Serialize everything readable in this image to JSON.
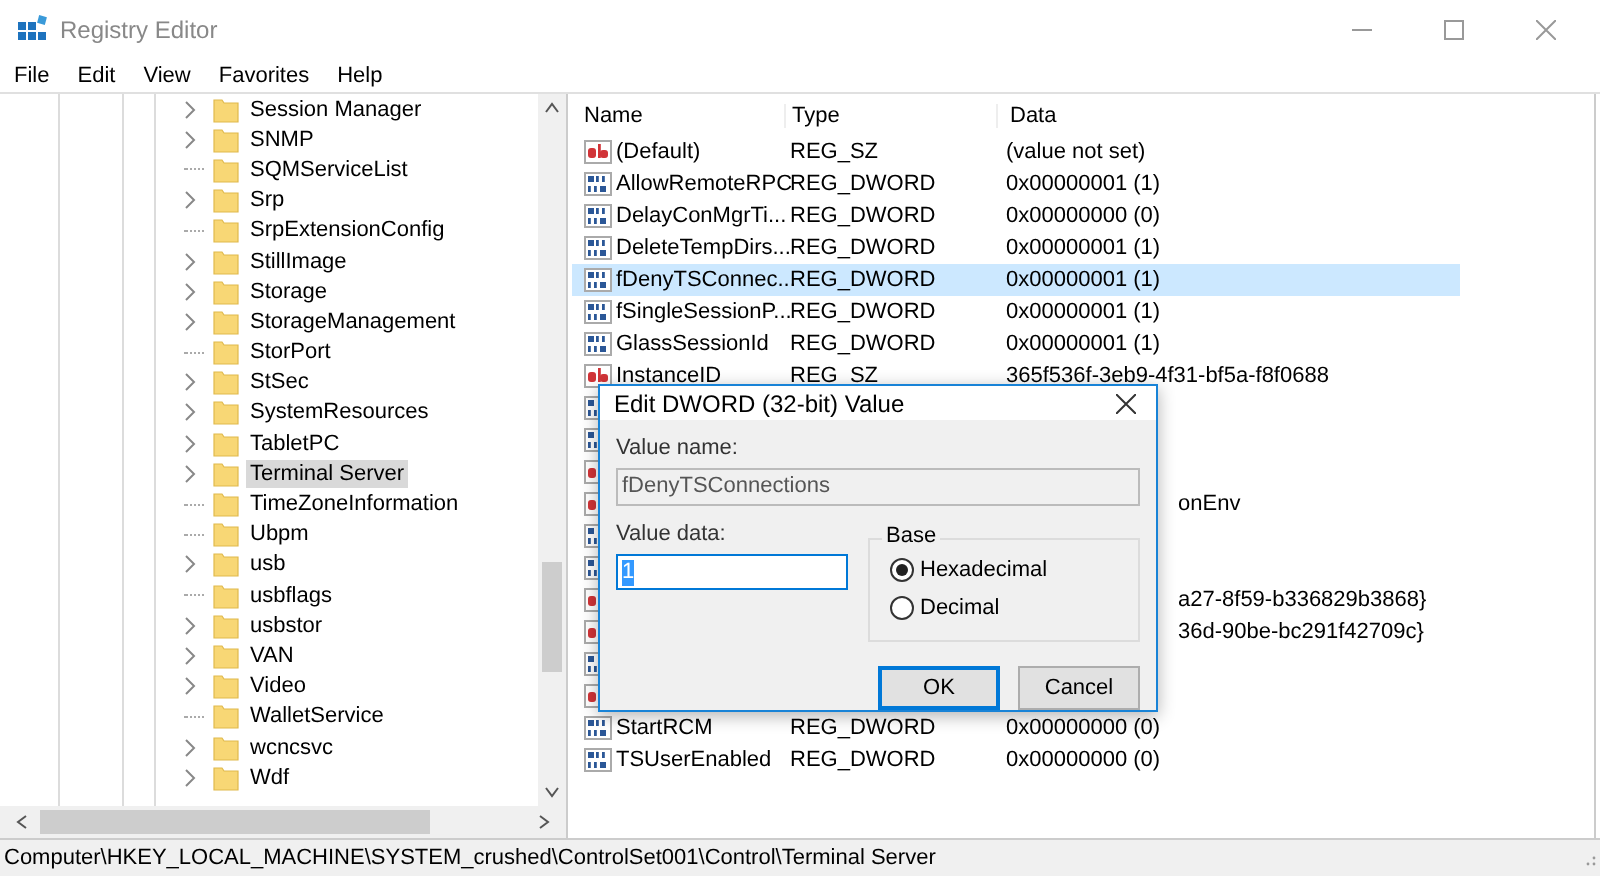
{
  "window": {
    "title": "Registry Editor"
  },
  "menu": [
    "File",
    "Edit",
    "View",
    "Favorites",
    "Help"
  ],
  "tree": {
    "items": [
      {
        "label": "Session Manager",
        "expandable": true,
        "selected": false
      },
      {
        "label": "SNMP",
        "expandable": true,
        "selected": false
      },
      {
        "label": "SQMServiceList",
        "expandable": false,
        "selected": false
      },
      {
        "label": "Srp",
        "expandable": true,
        "selected": false
      },
      {
        "label": "SrpExtensionConfig",
        "expandable": false,
        "selected": false
      },
      {
        "label": "StillImage",
        "expandable": true,
        "selected": false
      },
      {
        "label": "Storage",
        "expandable": true,
        "selected": false
      },
      {
        "label": "StorageManagement",
        "expandable": true,
        "selected": false
      },
      {
        "label": "StorPort",
        "expandable": false,
        "selected": false
      },
      {
        "label": "StSec",
        "expandable": true,
        "selected": false
      },
      {
        "label": "SystemResources",
        "expandable": true,
        "selected": false
      },
      {
        "label": "TabletPC",
        "expandable": true,
        "selected": false
      },
      {
        "label": "Terminal Server",
        "expandable": true,
        "selected": true
      },
      {
        "label": "TimeZoneInformation",
        "expandable": false,
        "selected": false
      },
      {
        "label": "Ubpm",
        "expandable": false,
        "selected": false
      },
      {
        "label": "usb",
        "expandable": true,
        "selected": false
      },
      {
        "label": "usbflags",
        "expandable": false,
        "selected": false
      },
      {
        "label": "usbstor",
        "expandable": true,
        "selected": false
      },
      {
        "label": "VAN",
        "expandable": true,
        "selected": false
      },
      {
        "label": "Video",
        "expandable": true,
        "selected": false
      },
      {
        "label": "WalletService",
        "expandable": false,
        "selected": false
      },
      {
        "label": "wcncsvc",
        "expandable": true,
        "selected": false
      },
      {
        "label": "Wdf",
        "expandable": true,
        "selected": false
      }
    ]
  },
  "table": {
    "columns": [
      "Name",
      "Type",
      "Data"
    ],
    "rows": [
      {
        "kind": "sz",
        "name": "(Default)",
        "type": "REG_SZ",
        "data": "(value not set)",
        "selected": false
      },
      {
        "kind": "dword",
        "name": "AllowRemoteRPC",
        "type": "REG_DWORD",
        "data": "0x00000001 (1)",
        "selected": false
      },
      {
        "kind": "dword",
        "name": "DelayConMgrTi...",
        "type": "REG_DWORD",
        "data": "0x00000000 (0)",
        "selected": false
      },
      {
        "kind": "dword",
        "name": "DeleteTempDirs...",
        "type": "REG_DWORD",
        "data": "0x00000001 (1)",
        "selected": false
      },
      {
        "kind": "dword",
        "name": "fDenyTSConnec...",
        "type": "REG_DWORD",
        "data": "0x00000001 (1)",
        "selected": true
      },
      {
        "kind": "dword",
        "name": "fSingleSessionP...",
        "type": "REG_DWORD",
        "data": "0x00000001 (1)",
        "selected": false
      },
      {
        "kind": "dword",
        "name": "GlassSessionId",
        "type": "REG_DWORD",
        "data": "0x00000001 (1)",
        "selected": false
      },
      {
        "kind": "sz",
        "name": "InstanceID",
        "type": "REG_SZ",
        "data": "365f536f-3eb9-4f31-bf5a-f8f0688",
        "selected": false
      },
      {
        "kind": "dword",
        "selected": false
      },
      {
        "kind": "dword",
        "selected": false
      },
      {
        "kind": "sz",
        "selected": false
      },
      {
        "kind": "sz",
        "data_tail": "onEnv",
        "selected": false
      },
      {
        "kind": "dword",
        "selected": false
      },
      {
        "kind": "dword",
        "selected": false
      },
      {
        "kind": "sz",
        "data_tail": "a27-8f59-b336829b3868}",
        "selected": false
      },
      {
        "kind": "sz",
        "data_tail": "36d-90be-bc291f42709c}",
        "selected": false
      },
      {
        "kind": "dword",
        "selected": false
      },
      {
        "kind": "sz",
        "selected": false
      },
      {
        "kind": "dword",
        "name": "StartRCM",
        "type": "REG_DWORD",
        "data": "0x00000000 (0)",
        "selected": false
      },
      {
        "kind": "dword",
        "name": "TSUserEnabled",
        "type": "REG_DWORD",
        "data": "0x00000000 (0)",
        "selected": false
      }
    ]
  },
  "dialog": {
    "title": "Edit DWORD (32-bit) Value",
    "value_name_label": "Value name:",
    "value_name": "fDenyTSConnections",
    "value_data_label": "Value data:",
    "value_data": "1",
    "base_label": "Base",
    "radios": [
      {
        "label": "Hexadecimal",
        "selected": true
      },
      {
        "label": "Decimal",
        "selected": false
      }
    ],
    "buttons": [
      {
        "label": "OK",
        "default": true
      },
      {
        "label": "Cancel",
        "default": false
      }
    ]
  },
  "status_bar": "Computer\\HKEY_LOCAL_MACHINE\\SYSTEM_crushed\\ControlSet001\\Control\\Terminal Server"
}
